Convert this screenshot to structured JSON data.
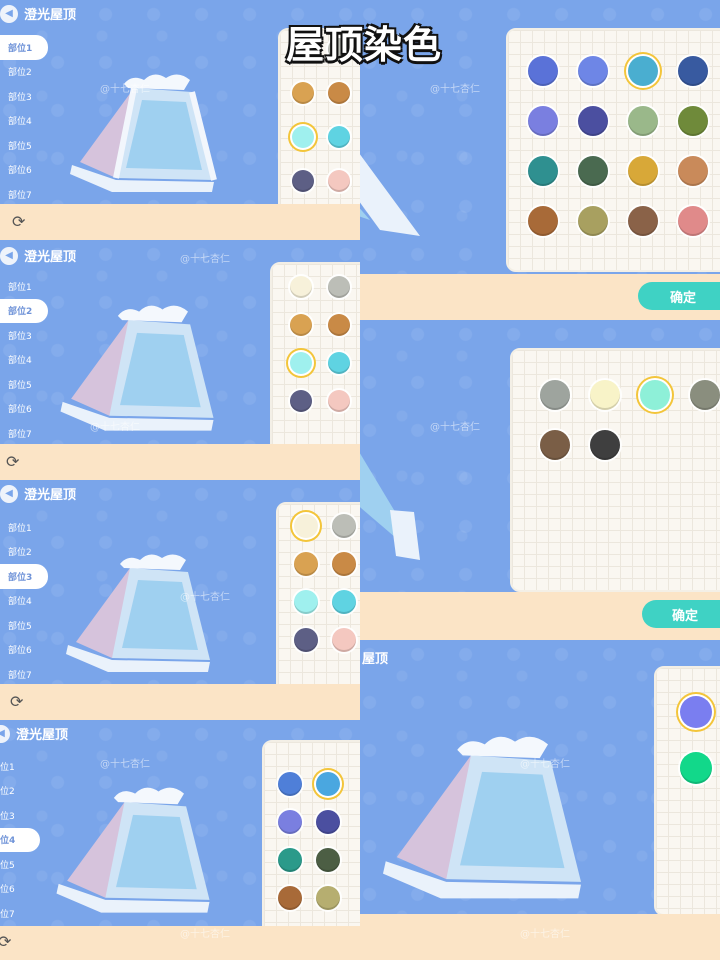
{
  "title": "屋顶染色",
  "header_title": "澄光屋顶",
  "header_title_partial": "屋顶",
  "parts": [
    "部位1",
    "部位2",
    "部位3",
    "部位4",
    "部位5",
    "部位6",
    "部位7"
  ],
  "parts_partial": [
    "位1",
    "位2",
    "位3",
    "位4",
    "位5",
    "位6",
    "位7"
  ],
  "confirm_label": "确定",
  "watermark": "@十七杏仁",
  "icons": {
    "back": "back-arrow-icon",
    "refresh": "refresh-icon"
  },
  "colors": {
    "bg_blue": "#7aa5ea",
    "bar": "#fbe4c6",
    "confirm": "#3fd2c4",
    "select_ring": "#f3c53a"
  },
  "panels": [
    {
      "selected_part": 1,
      "swatches": [
        "#f5efd2",
        "#bdbfb8",
        "#d9a252",
        "#c98a46",
        "#9ff0ee",
        "#5fd3e2",
        "#5d5f85",
        "#f4c8c0"
      ],
      "selected_swatch": 4
    },
    {
      "selected_part": 2,
      "swatches": [
        "#f7f1da",
        "#bcbeb7",
        "#d9a252",
        "#c98a46",
        "#9ff0ee",
        "#5fd3e2",
        "#5d5f85",
        "#f4c8c0"
      ],
      "selected_swatch": 4
    },
    {
      "selected_part": 3,
      "swatches": [
        "#f7f1da",
        "#bcbeb7",
        "#d9a252",
        "#c98a46",
        "#9ff0ee",
        "#5fd3e2",
        "#5d5f85",
        "#f4c8c0"
      ],
      "selected_swatch": 0
    },
    {
      "selected_part": 4,
      "swatches": [
        "#4f7fd8",
        "#4aa7e0",
        "#7a7fe0",
        "#4b4fa0",
        "#2b9a8a",
        "#4c5e44",
        "#a86a38",
        "#b6ae70"
      ],
      "selected_swatch": 1
    },
    {
      "swatches": [
        "#5a72d8",
        "#6e86e6",
        "#4aaed0",
        "#385aa0",
        "#7a7fe0",
        "#4b4fa0",
        "#9ab88a",
        "#6f8a3a",
        "#2f9090",
        "#4a6a50",
        "#d8a838",
        "#c98a5a",
        "#a86a38",
        "#a8a060",
        "#8a6248",
        "#e08a8a"
      ],
      "selected_swatch": 2
    },
    {
      "swatches": [
        "#9ea49e",
        "#f8f3c8",
        "#8ef0d8",
        "#8a8e7e",
        "#7a5e46",
        "#3f3f3f"
      ],
      "selected_swatch": 2
    },
    {
      "swatches": [
        "#7a7ef0",
        "#12d88a"
      ],
      "selected_swatch": 0
    }
  ]
}
